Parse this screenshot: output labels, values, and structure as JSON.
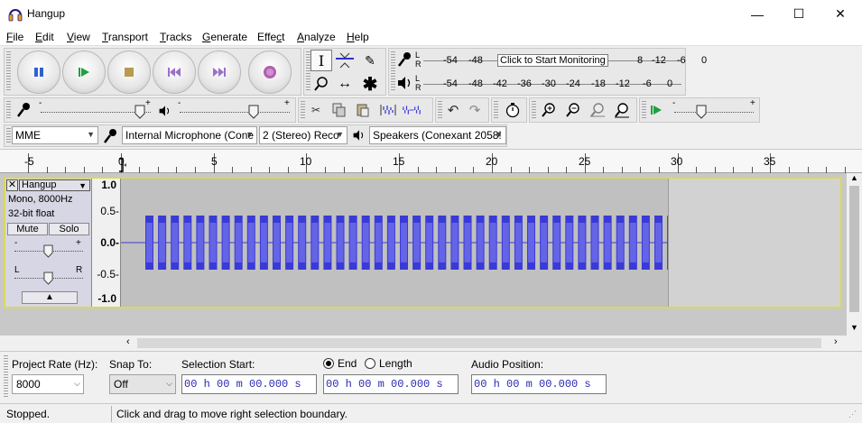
{
  "window": {
    "title": "Hangup",
    "minimize": "—",
    "maximize": "☐",
    "close": "✕"
  },
  "menu": [
    {
      "key": "F",
      "rest": "ile"
    },
    {
      "key": "E",
      "rest": "dit"
    },
    {
      "key": "V",
      "rest": "iew"
    },
    {
      "key": "T",
      "rest": "ransport"
    },
    {
      "key": "T",
      "rest": "racks"
    },
    {
      "key": "G",
      "rest": "enerate"
    },
    {
      "key": "",
      "rest": "Effe",
      "key2": "c",
      "rest2": "t"
    },
    {
      "key": "A",
      "rest": "nalyze"
    },
    {
      "key": "H",
      "rest": "elp"
    }
  ],
  "meters": {
    "record_ticks": [
      "-54",
      "-48",
      "-12",
      "-6",
      "0"
    ],
    "record_hint": "Click to Start Monitoring",
    "record_hint_tail": "8",
    "play_ticks": [
      "-54",
      "-48",
      "-42",
      "-36",
      "-30",
      "-24",
      "-18",
      "-12",
      "-6",
      "0"
    ],
    "lr_left": "L",
    "lr_right": "R"
  },
  "slider_marks": {
    "minus": "-",
    "plus": "+"
  },
  "devices": {
    "host": "MME",
    "input": "Internal Microphone (Cone",
    "channels": "2 (Stereo) Reco",
    "output": "Speakers (Conexant 2058!"
  },
  "ruler": {
    "labels": [
      "-5",
      "0",
      "5",
      "10",
      "15",
      "20",
      "25",
      "30",
      "35"
    ]
  },
  "track": {
    "name": "Hangup",
    "info1": "Mono, 8000Hz",
    "info2": "32-bit float",
    "mute": "Mute",
    "solo": "Solo",
    "gain_minus": "-",
    "gain_plus": "+",
    "pan_left": "L",
    "pan_right": "R",
    "vruler": [
      "1.0",
      "0.5-",
      "0.0-",
      "-0.5-",
      "-1.0"
    ]
  },
  "selection_toolbar": {
    "project_rate_label": "Project Rate (Hz):",
    "project_rate": "8000",
    "snap_label": "Snap To:",
    "snap": "Off",
    "sel_start_label": "Selection Start:",
    "end_label": "End",
    "length_label": "Length",
    "audio_pos_label": "Audio Position:",
    "time_value": "00 h 00 m 00.000 s"
  },
  "status": {
    "state": "Stopped.",
    "hint": "Click and drag to move right selection boundary."
  },
  "colors": {
    "waveform": "#3a3ad6",
    "waveform_light": "#6464e6",
    "track_border": "#d8d85a",
    "timecode": "#2a2ab0"
  }
}
